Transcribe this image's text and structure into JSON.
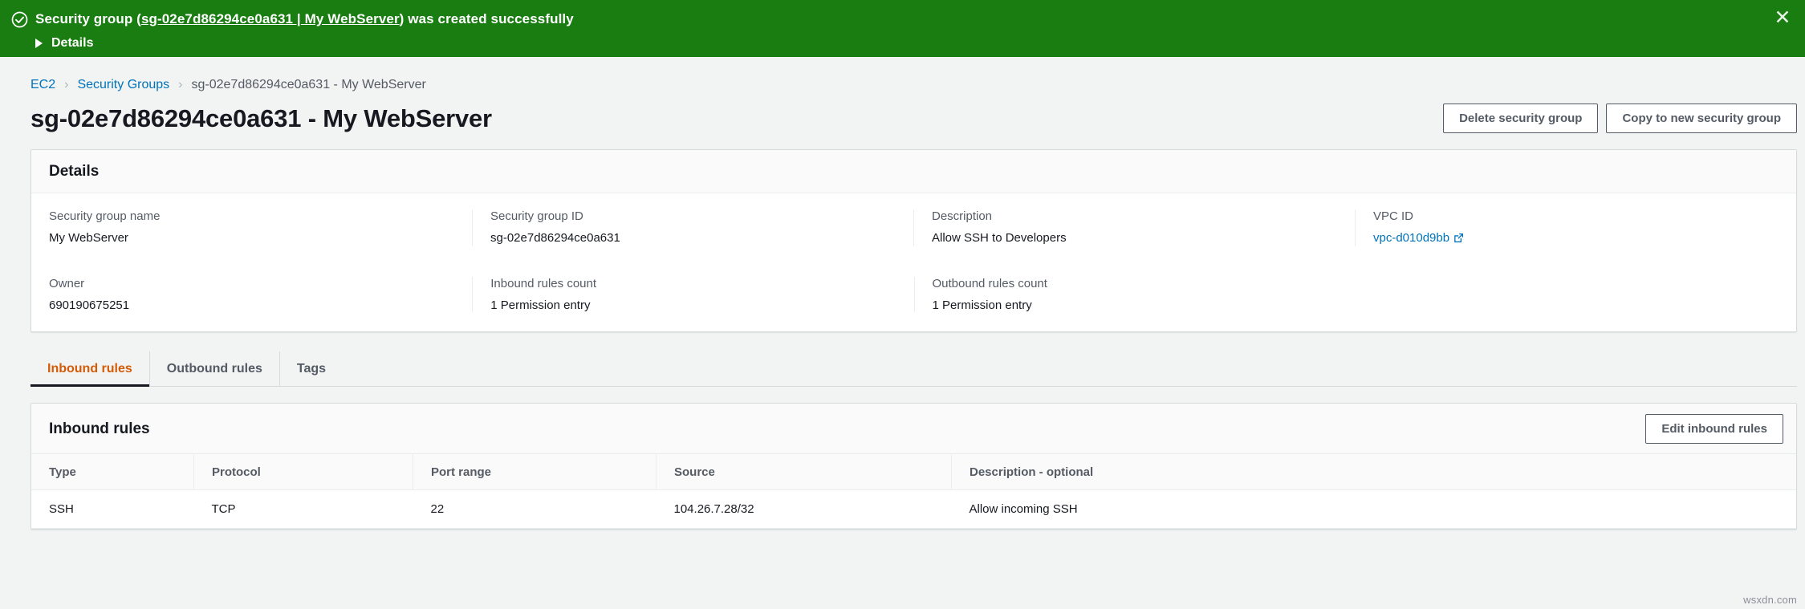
{
  "banner": {
    "icon": "circle-check-icon",
    "message_prefix": "Security group (",
    "message_link": "sg-02e7d86294ce0a631 | My WebServer",
    "message_suffix": ") was created successfully",
    "details_label": "Details",
    "close_icon": "close-icon",
    "background_color": "#1a7d11"
  },
  "breadcrumb": {
    "items": [
      {
        "label": "EC2",
        "type": "link"
      },
      {
        "label": "Security Groups",
        "type": "link"
      },
      {
        "label": "sg-02e7d86294ce0a631 - My WebServer",
        "type": "current"
      }
    ],
    "separator": "›"
  },
  "header": {
    "title": "sg-02e7d86294ce0a631 - My WebServer",
    "actions": [
      {
        "label": "Delete security group"
      },
      {
        "label": "Copy to new security group"
      }
    ]
  },
  "details_panel": {
    "title": "Details",
    "row1": [
      {
        "label": "Security group name",
        "value": "My WebServer"
      },
      {
        "label": "Security group ID",
        "value": "sg-02e7d86294ce0a631"
      },
      {
        "label": "Description",
        "value": "Allow SSH to Developers"
      },
      {
        "label": "VPC ID",
        "value": "vpc-d010d9bb",
        "is_link": true,
        "icon": "external-link-icon"
      }
    ],
    "row2": [
      {
        "label": "Owner",
        "value": "690190675251"
      },
      {
        "label": "Inbound rules count",
        "value": "1 Permission entry"
      },
      {
        "label": "Outbound rules count",
        "value": "1 Permission entry"
      }
    ]
  },
  "tabs": [
    {
      "label": "Inbound rules",
      "active": true
    },
    {
      "label": "Outbound rules",
      "active": false
    },
    {
      "label": "Tags",
      "active": false
    }
  ],
  "rules_panel": {
    "title": "Inbound rules",
    "edit_button": "Edit inbound rules",
    "columns": [
      "Type",
      "Protocol",
      "Port range",
      "Source",
      "Description - optional"
    ],
    "rows": [
      {
        "type": "SSH",
        "protocol": "TCP",
        "port_range": "22",
        "source": "104.26.7.28/32",
        "description": "Allow incoming SSH"
      }
    ]
  },
  "watermark": "wsxdn.com",
  "colors": {
    "success_green": "#1a7d11",
    "link_blue": "#0073bb",
    "active_tab_orange": "#d45b07",
    "page_background": "#f2f3f3"
  }
}
